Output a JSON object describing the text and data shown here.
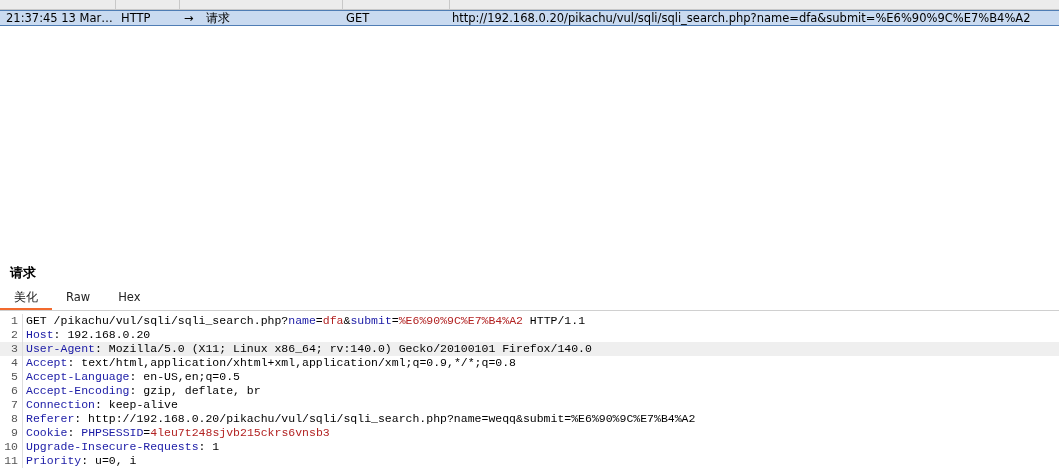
{
  "history_table": {
    "rows": [
      {
        "time": "21:37:45 13 Mar…",
        "type": "HTTP",
        "direction_arrow": "→",
        "direction": "请求",
        "method": "GET",
        "url": "http://192.168.0.20/pikachu/vul/sqli/sqli_search.php?name=dfa&submit=%E6%90%9C%E7%B4%A2",
        "selected": true
      }
    ]
  },
  "request_panel": {
    "title": "请求",
    "tabs": [
      {
        "label": "美化",
        "selected": true
      },
      {
        "label": "Raw",
        "selected": false
      },
      {
        "label": "Hex",
        "selected": false
      }
    ],
    "lines": [
      {
        "number": "1",
        "highlighted": false,
        "segments": [
          {
            "kind": "plain",
            "text": "GET /pikachu/vul/sqli/sqli_search.php?"
          },
          {
            "kind": "key",
            "text": "name"
          },
          {
            "kind": "plain",
            "text": "="
          },
          {
            "kind": "value",
            "text": "dfa"
          },
          {
            "kind": "plain",
            "text": "&"
          },
          {
            "kind": "key",
            "text": "submit"
          },
          {
            "kind": "plain",
            "text": "="
          },
          {
            "kind": "value",
            "text": "%E6%90%9C%E7%B4%A2"
          },
          {
            "kind": "plain",
            "text": " HTTP/1.1"
          }
        ]
      },
      {
        "number": "2",
        "highlighted": false,
        "segments": [
          {
            "kind": "key",
            "text": "Host"
          },
          {
            "kind": "plain",
            "text": ": 192.168.0.20"
          }
        ]
      },
      {
        "number": "3",
        "highlighted": true,
        "segments": [
          {
            "kind": "key",
            "text": "User-Agent"
          },
          {
            "kind": "plain",
            "text": ": Mozilla/5.0 (X11; Linux x86_64; rv:140.0) Gecko/20100101 Firefox/140.0"
          }
        ]
      },
      {
        "number": "4",
        "highlighted": false,
        "segments": [
          {
            "kind": "key",
            "text": "Accept"
          },
          {
            "kind": "plain",
            "text": ": text/html,application/xhtml+xml,application/xml;q=0.9,*/*;q=0.8"
          }
        ]
      },
      {
        "number": "5",
        "highlighted": false,
        "segments": [
          {
            "kind": "key",
            "text": "Accept-Language"
          },
          {
            "kind": "plain",
            "text": ": en-US,en;q=0.5"
          }
        ]
      },
      {
        "number": "6",
        "highlighted": false,
        "segments": [
          {
            "kind": "key",
            "text": "Accept-Encoding"
          },
          {
            "kind": "plain",
            "text": ": gzip, deflate, br"
          }
        ]
      },
      {
        "number": "7",
        "highlighted": false,
        "segments": [
          {
            "kind": "key",
            "text": "Connection"
          },
          {
            "kind": "plain",
            "text": ": keep-alive"
          }
        ]
      },
      {
        "number": "8",
        "highlighted": false,
        "segments": [
          {
            "kind": "key",
            "text": "Referer"
          },
          {
            "kind": "plain",
            "text": ": http://192.168.0.20/pikachu/vul/sqli/sqli_search.php?name=weqq&submit=%E6%90%9C%E7%B4%A2"
          }
        ]
      },
      {
        "number": "9",
        "highlighted": false,
        "segments": [
          {
            "kind": "key",
            "text": "Cookie"
          },
          {
            "kind": "plain",
            "text": ": "
          },
          {
            "kind": "key",
            "text": "PHPSESSID"
          },
          {
            "kind": "plain",
            "text": "="
          },
          {
            "kind": "value",
            "text": "4leu7t248sjvb215ckrs6vnsb3"
          }
        ]
      },
      {
        "number": "10",
        "highlighted": false,
        "segments": [
          {
            "kind": "key",
            "text": "Upgrade-Insecure-Requests"
          },
          {
            "kind": "plain",
            "text": ": 1"
          }
        ]
      },
      {
        "number": "11",
        "highlighted": false,
        "segments": [
          {
            "kind": "key",
            "text": "Priority"
          },
          {
            "kind": "plain",
            "text": ": u=0, i"
          }
        ]
      }
    ]
  }
}
